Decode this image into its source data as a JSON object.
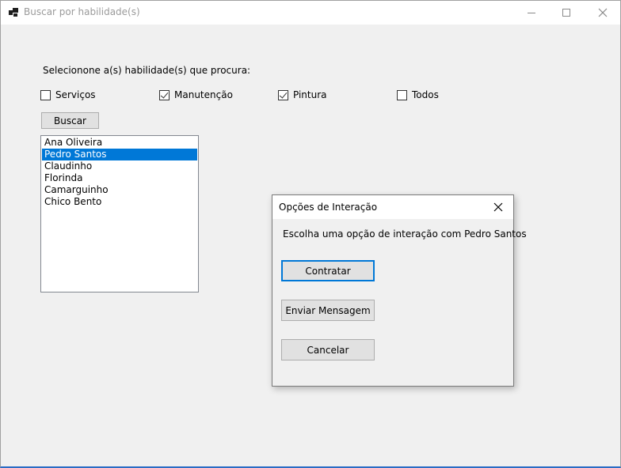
{
  "window": {
    "title": "Buscar por habilidade(s)",
    "icon": "app-icon",
    "controls": {
      "minimize": "minimize-icon",
      "maximize": "maximize-icon",
      "close": "close-icon"
    }
  },
  "form": {
    "prompt": "Selecionone a(s) habilidade(s) que procura:",
    "checkboxes": [
      {
        "label": "Serviços",
        "checked": false
      },
      {
        "label": "Manutenção",
        "checked": true
      },
      {
        "label": "Pintura",
        "checked": true
      },
      {
        "label": "Todos",
        "checked": false
      }
    ],
    "search_button": "Buscar",
    "results": [
      "Ana Oliveira",
      "Pedro Santos",
      "Claudinho",
      "Florinda",
      "Camarguinho",
      "Chico Bento"
    ],
    "selected_result": "Pedro Santos"
  },
  "dialog": {
    "title": "Opções de Interação",
    "message": "Escolha uma opção de interação com Pedro Santos",
    "buttons": {
      "hire": "Contratar",
      "message": "Enviar Mensagem",
      "cancel": "Cancelar"
    }
  },
  "colors": {
    "selection": "#0078d7",
    "focus_border": "#0078d7"
  }
}
